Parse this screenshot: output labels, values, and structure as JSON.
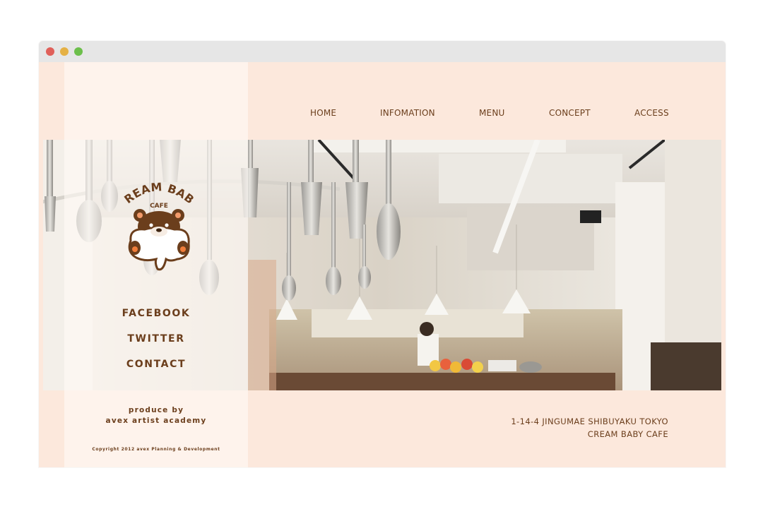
{
  "nav": {
    "home": "HOME",
    "information": "INFOMATION",
    "menu": "MENU",
    "concept": "CONCEPT",
    "access": "ACCESS"
  },
  "logo": {
    "line1": "CREAM BABY",
    "line2": "CAFE"
  },
  "social": {
    "facebook": "FACEBOOK",
    "twitter": "TWITTER",
    "contact": "CONTACT"
  },
  "footer": {
    "produce_line1": "produce by",
    "produce_line2": "avex artist academy",
    "copyright": "Copyright 2012 avex Planning & Development",
    "address_line1": "1-14-4 JINGUMAE SHIBUYAKU TOKYO",
    "address_line2": "CREAM BABY CAFE"
  },
  "colors": {
    "background": "#fce8dc",
    "text_brown": "#6b3e1c",
    "titlebar": "#e6e6e6"
  }
}
